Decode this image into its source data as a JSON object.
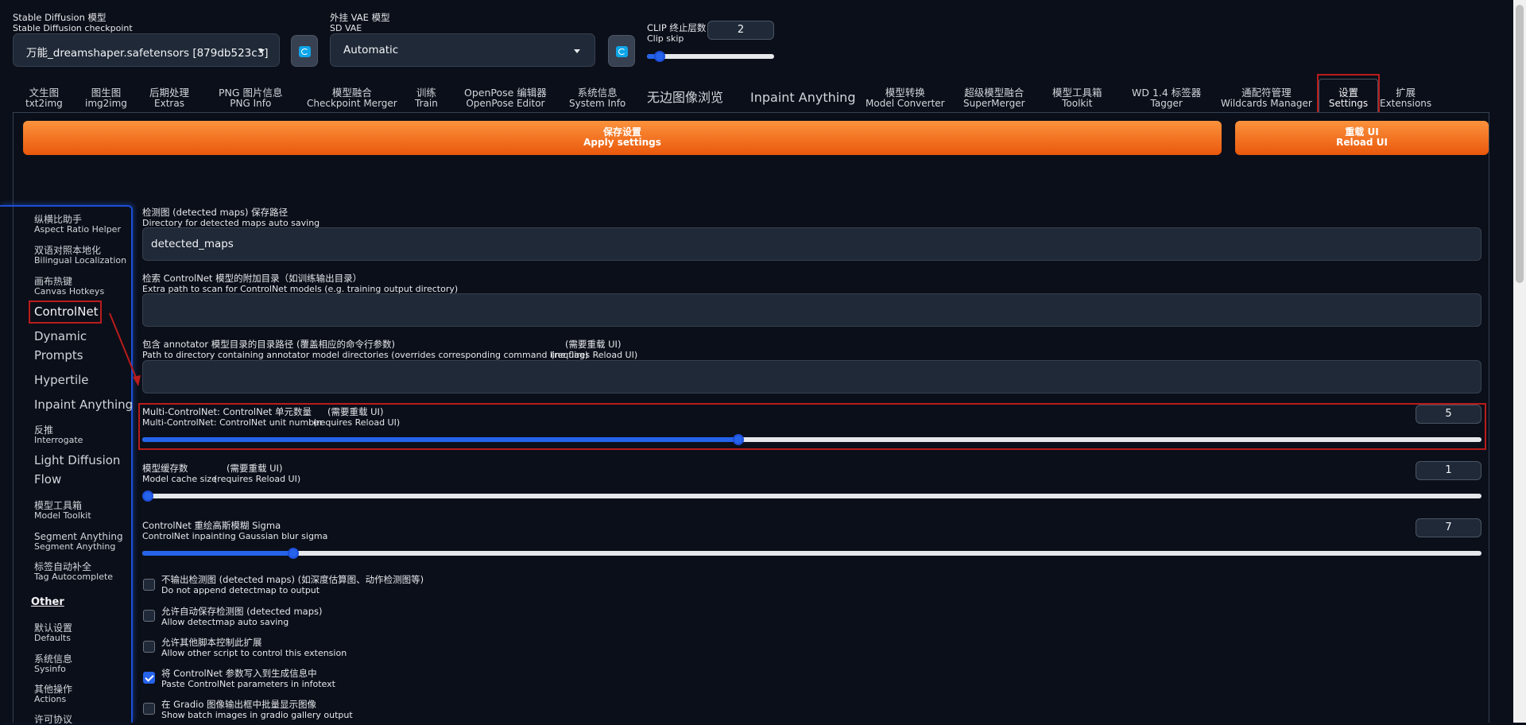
{
  "top": {
    "checkpoint_label_zh": "Stable Diffusion 模型",
    "checkpoint_label_en": "Stable Diffusion checkpoint",
    "checkpoint_value": "万能_dreamshaper.safetensors [879db523c3]",
    "vae_label_zh": "外挂 VAE 模型",
    "vae_label_en": "SD VAE",
    "vae_value": "Automatic",
    "clip_label_zh": "CLIP 终止层数",
    "clip_label_en": "Clip skip",
    "clip_value": "2",
    "clip_fraction": 0.1
  },
  "tabs": [
    {
      "zh": "文生图",
      "en": "txt2img"
    },
    {
      "zh": "图生图",
      "en": "img2img"
    },
    {
      "zh": "后期处理",
      "en": "Extras"
    },
    {
      "zh": "PNG 图片信息",
      "en": "PNG Info"
    },
    {
      "zh": "模型融合",
      "en": "Checkpoint Merger"
    },
    {
      "zh": "训练",
      "en": "Train"
    },
    {
      "zh": "OpenPose 编辑器",
      "en": "OpenPose Editor"
    },
    {
      "zh": "系统信息",
      "en": "System Info"
    },
    {
      "zh": "无边图像浏览",
      "en": ""
    },
    {
      "zh": "Inpaint Anything",
      "en": ""
    },
    {
      "zh": "模型转换",
      "en": "Model Converter"
    },
    {
      "zh": "超级模型融合",
      "en": "SuperMerger"
    },
    {
      "zh": "模型工具箱",
      "en": "Toolkit"
    },
    {
      "zh": "WD 1.4 标签器",
      "en": "Tagger"
    },
    {
      "zh": "通配符管理",
      "en": "Wildcards Manager"
    },
    {
      "zh": "设置",
      "en": "Settings"
    },
    {
      "zh": "扩展",
      "en": "Extensions"
    }
  ],
  "buttons": {
    "apply_zh": "保存设置",
    "apply_en": "Apply settings",
    "reload_zh": "重载 UI",
    "reload_en": "Reload UI"
  },
  "sidebar": {
    "items": [
      {
        "zh": "纵横比助手",
        "en": "Aspect Ratio Helper"
      },
      {
        "zh": "双语对照本地化",
        "en": "Bilingual Localization"
      },
      {
        "zh": "画布热键",
        "en": "Canvas Hotkeys"
      },
      {
        "big": "ControlNet"
      },
      {
        "big": "Dynamic"
      },
      {
        "big": "Prompts"
      },
      {
        "big": "Hypertile"
      },
      {
        "big": "Inpaint Anything"
      },
      {
        "zh": "反推",
        "en": "Interrogate"
      },
      {
        "big": "Light Diffusion"
      },
      {
        "big": "Flow"
      },
      {
        "zh": "模型工具箱",
        "en": "Model Toolkit"
      },
      {
        "zh": "Segment Anything",
        "en": "Segment Anything"
      },
      {
        "zh": "标签自动补全",
        "en": "Tag Autocomplete"
      },
      {
        "big": "Other"
      },
      {
        "zh": "默认设置",
        "en": "Defaults"
      },
      {
        "zh": "系统信息",
        "en": "Sysinfo"
      },
      {
        "zh": "其他操作",
        "en": "Actions"
      },
      {
        "zh": "许可协议",
        "en": ""
      }
    ]
  },
  "settings": {
    "detected_dir_zh": "检测图 (detected maps) 保存路径",
    "detected_dir_en": "Directory for detected maps auto saving",
    "detected_dir_value": "detected_maps",
    "extra_path_zh": "检索 ControlNet 模型的附加目录（如训练输出目录）",
    "extra_path_en": "Extra path to scan for ControlNet models (e.g. training output directory)",
    "extra_path_value": "",
    "annotator_zh": "包含 annotator 模型目录的目录路径 (覆盖相应的命令行参数)",
    "annotator_req_zh": "(需要重载 UI)",
    "annotator_en": "Path to directory containing annotator model directories (overrides corresponding command line flag)",
    "annotator_req_en": "(requires Reload UI)",
    "annotator_value": "",
    "unit_zh": "Multi-ControlNet: ControlNet 单元数量",
    "unit_req_zh": "(需要重载 UI)",
    "unit_en": "Multi-ControlNet: ControlNet unit number",
    "unit_req_en": "(requires Reload UI)",
    "unit_value": "5",
    "unit_fraction": 0.445,
    "cache_zh": "模型缓存数",
    "cache_req_zh": "(需要重载 UI)",
    "cache_en": "Model cache size",
    "cache_req_en": "(requires Reload UI)",
    "cache_value": "1",
    "cache_fraction": 0.0,
    "sigma_zh": "ControlNet 重绘高斯模糊 Sigma",
    "sigma_en": "ControlNet inpainting Gaussian blur sigma",
    "sigma_value": "7",
    "sigma_fraction": 0.113,
    "checks": [
      {
        "zh": "不输出检测图 (detected maps) (如深度估算图、动作检测图等)",
        "en": "Do not append detectmap to output",
        "checked": false
      },
      {
        "zh": "允许自动保存检测图 (detected maps)",
        "en": "Allow detectmap auto saving",
        "checked": false
      },
      {
        "zh": "允许其他脚本控制此扩展",
        "en": "Allow other script to control this extension",
        "checked": false
      },
      {
        "zh": "将 ControlNet 参数写入到生成信息中",
        "en": "Paste ControlNet parameters in infotext",
        "checked": true
      },
      {
        "zh": "在 Gradio 图像输出框中批量显示图像",
        "en": "Show batch images in gradio gallery output",
        "checked": false
      }
    ]
  },
  "colors": {
    "accent": "#2563eb",
    "orange": "#f97316",
    "highlight": "#b91c1c",
    "background": "#0b0f19"
  }
}
